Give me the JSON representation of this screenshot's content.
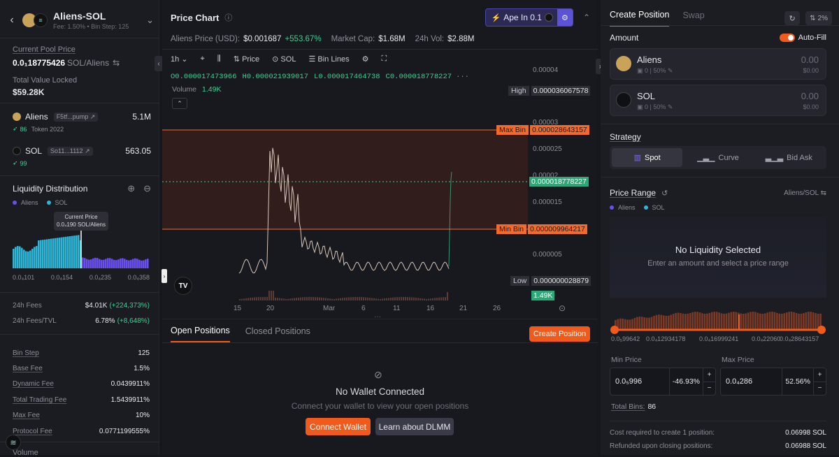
{
  "pool": {
    "name": "Aliens-SOL",
    "fee": "Fee: 1.50%",
    "bin_step_text": "Bin Step: 125",
    "current_price_label": "Current Pool Price",
    "current_price_value": "0.0₁18775426",
    "current_price_unit": "SOL/Aliens",
    "tvl_label": "Total Value Locked",
    "tvl_value": "$59.28K",
    "tokens": [
      {
        "name": "Aliens",
        "addr": "F5tf...pump",
        "amount": "5.1M",
        "score": "86",
        "tag": "Token 2022"
      },
      {
        "name": "SOL",
        "addr": "So11...1112",
        "amount": "563.05",
        "score": "99",
        "tag": ""
      }
    ]
  },
  "liquidity": {
    "title": "Liquidity Distribution",
    "legend": [
      "Aliens",
      "SOL"
    ],
    "tooltip_title": "Current Price",
    "tooltip_value": "0.0₄190 SOL/Aliens",
    "axis": [
      "0.0₄101",
      "0.0₄154",
      "0.0₄235",
      "0.0₄358"
    ],
    "colors": {
      "aliens": "#6a4ff0",
      "sol": "#2fb6d6"
    }
  },
  "fees": {
    "fees_24h_label": "24h Fees",
    "fees_24h_value": "$4.01K",
    "fees_24h_change": "(+224,373%)",
    "fees_tvl_label": "24h Fees/TVL",
    "fees_tvl_value": "6.78%",
    "fees_tvl_change": "(+8,648%)",
    "rows": [
      {
        "label": "Bin Step",
        "value": "125"
      },
      {
        "label": "Base Fee",
        "value": "1.5%"
      },
      {
        "label": "Dynamic Fee",
        "value": "0.0439911%"
      },
      {
        "label": "Total Trading Fee",
        "value": "1.5439911%"
      },
      {
        "label": "Max Fee",
        "value": "10%"
      },
      {
        "label": "Protocol Fee",
        "value": "0.0771199555%"
      }
    ],
    "volume_label": "Volume"
  },
  "chart": {
    "title": "Price Chart",
    "ape_label": "Ape In 0.1",
    "price_usd_label": "Aliens Price (USD):",
    "price_usd_value": "$0.001687",
    "price_change": "+553.67%",
    "mcap_label": "Market Cap:",
    "mcap_value": "$1.68M",
    "vol_label": "24h Vol:",
    "vol_value": "$2.88M",
    "toolbar": {
      "interval": "1h",
      "price": "Price",
      "sol": "SOL",
      "bin_lines": "Bin Lines"
    },
    "ohlc": {
      "o": "O0.000017473966",
      "h": "H0.000021939017",
      "l": "L0.000017464738",
      "c": "C0.000018778227"
    },
    "volume_label": "Volume",
    "volume_value": "1.49K",
    "y_ticks": [
      "0.00004",
      "0.00003",
      "0.000025",
      "0.00002",
      "0.000015",
      "0.00001",
      "0.000005"
    ],
    "x_ticks": [
      "15",
      "20",
      "Mar",
      "6",
      "11",
      "16",
      "21",
      "26"
    ],
    "markers": {
      "high_label": "High",
      "high_value": "0.000036067578",
      "max_label": "Max Bin",
      "max_value": "0.000028643157",
      "current_value": "0.000018778227",
      "min_label": "Min Bin",
      "min_value": "0.000009964217",
      "low_label": "Low",
      "low_value": "0.000000028879",
      "vol_value": "1.49K"
    }
  },
  "positions": {
    "tabs": [
      "Open Positions",
      "Closed Positions"
    ],
    "create_label": "Create Position",
    "empty_title": "No Wallet Connected",
    "empty_sub": "Connect your wallet to view your open positions",
    "connect_label": "Connect Wallet",
    "learn_label": "Learn about DLMM"
  },
  "form": {
    "tabs": [
      "Create Position",
      "Swap"
    ],
    "slippage": "2%",
    "amount_label": "Amount",
    "autofill_label": "Auto-Fill",
    "tokens": [
      {
        "name": "Aliens",
        "bal": "0",
        "pct": "50%",
        "amount": "0.00",
        "usd": "$0.00"
      },
      {
        "name": "SOL",
        "bal": "0",
        "pct": "50%",
        "amount": "0.00",
        "usd": "$0.00"
      }
    ],
    "strategy_label": "Strategy",
    "strategies": [
      "Spot",
      "Curve",
      "Bid Ask"
    ],
    "price_range_label": "Price Range",
    "pair_label": "Aliens/SOL",
    "legend": [
      "Aliens",
      "SOL"
    ],
    "empty_title": "No Liquidity Selected",
    "empty_sub": "Enter an amount and select a price range",
    "range_axis": [
      "0.0₅99642",
      "0.0₄12934178",
      "0.0₄16999241",
      "0.0₄22060",
      "0.0₄28643157"
    ],
    "min_label": "Min Price",
    "min_value": "0.0₅996",
    "min_pct": "-46.93%",
    "max_label": "Max Price",
    "max_value": "0.0₄286",
    "max_pct": "52.56%",
    "total_bins_label": "Total Bins:",
    "total_bins_value": "86",
    "cost_label": "Cost required to create 1 position:",
    "cost_value": "0.06998 SOL",
    "refund_label": "Refunded upon closing positions:",
    "refund_value": "0.06988 SOL"
  }
}
